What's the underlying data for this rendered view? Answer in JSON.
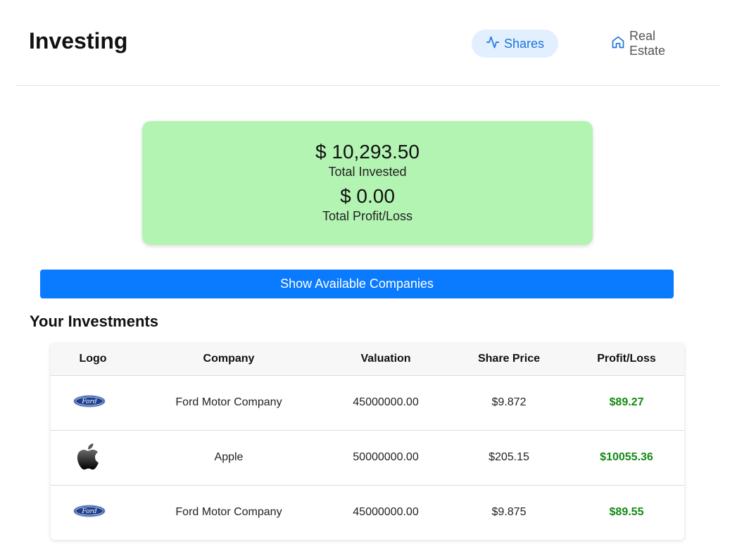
{
  "header": {
    "title": "Investing",
    "tabs": [
      {
        "label": "Shares",
        "icon": "activity-icon",
        "active": true
      },
      {
        "label": "Real Estate",
        "icon": "home-icon",
        "active": false
      }
    ]
  },
  "summary": {
    "total_invested": "$ 10,293.50",
    "total_invested_label": "Total Invested",
    "total_profit": "$ 0.00",
    "total_profit_label": "Total Profit/Loss"
  },
  "show_companies_label": "Show Available Companies",
  "investments": {
    "title": "Your Investments",
    "columns": [
      "Logo",
      "Company",
      "Valuation",
      "Share Price",
      "Profit/Loss"
    ],
    "rows": [
      {
        "logo": "ford-logo",
        "company": "Ford Motor Company",
        "valuation": "45000000.00",
        "share_price": "$9.872",
        "profit_loss": "$89.27"
      },
      {
        "logo": "apple-logo",
        "company": "Apple",
        "valuation": "50000000.00",
        "share_price": "$205.15",
        "profit_loss": "$10055.36"
      },
      {
        "logo": "ford-logo",
        "company": "Ford Motor Company",
        "valuation": "45000000.00",
        "share_price": "$9.875",
        "profit_loss": "$89.55"
      }
    ]
  },
  "colors": {
    "accent": "#0a7bff",
    "summary_bg": "#b3f4b3",
    "profit": "#138a13",
    "active_tab_bg": "#e2efff"
  }
}
